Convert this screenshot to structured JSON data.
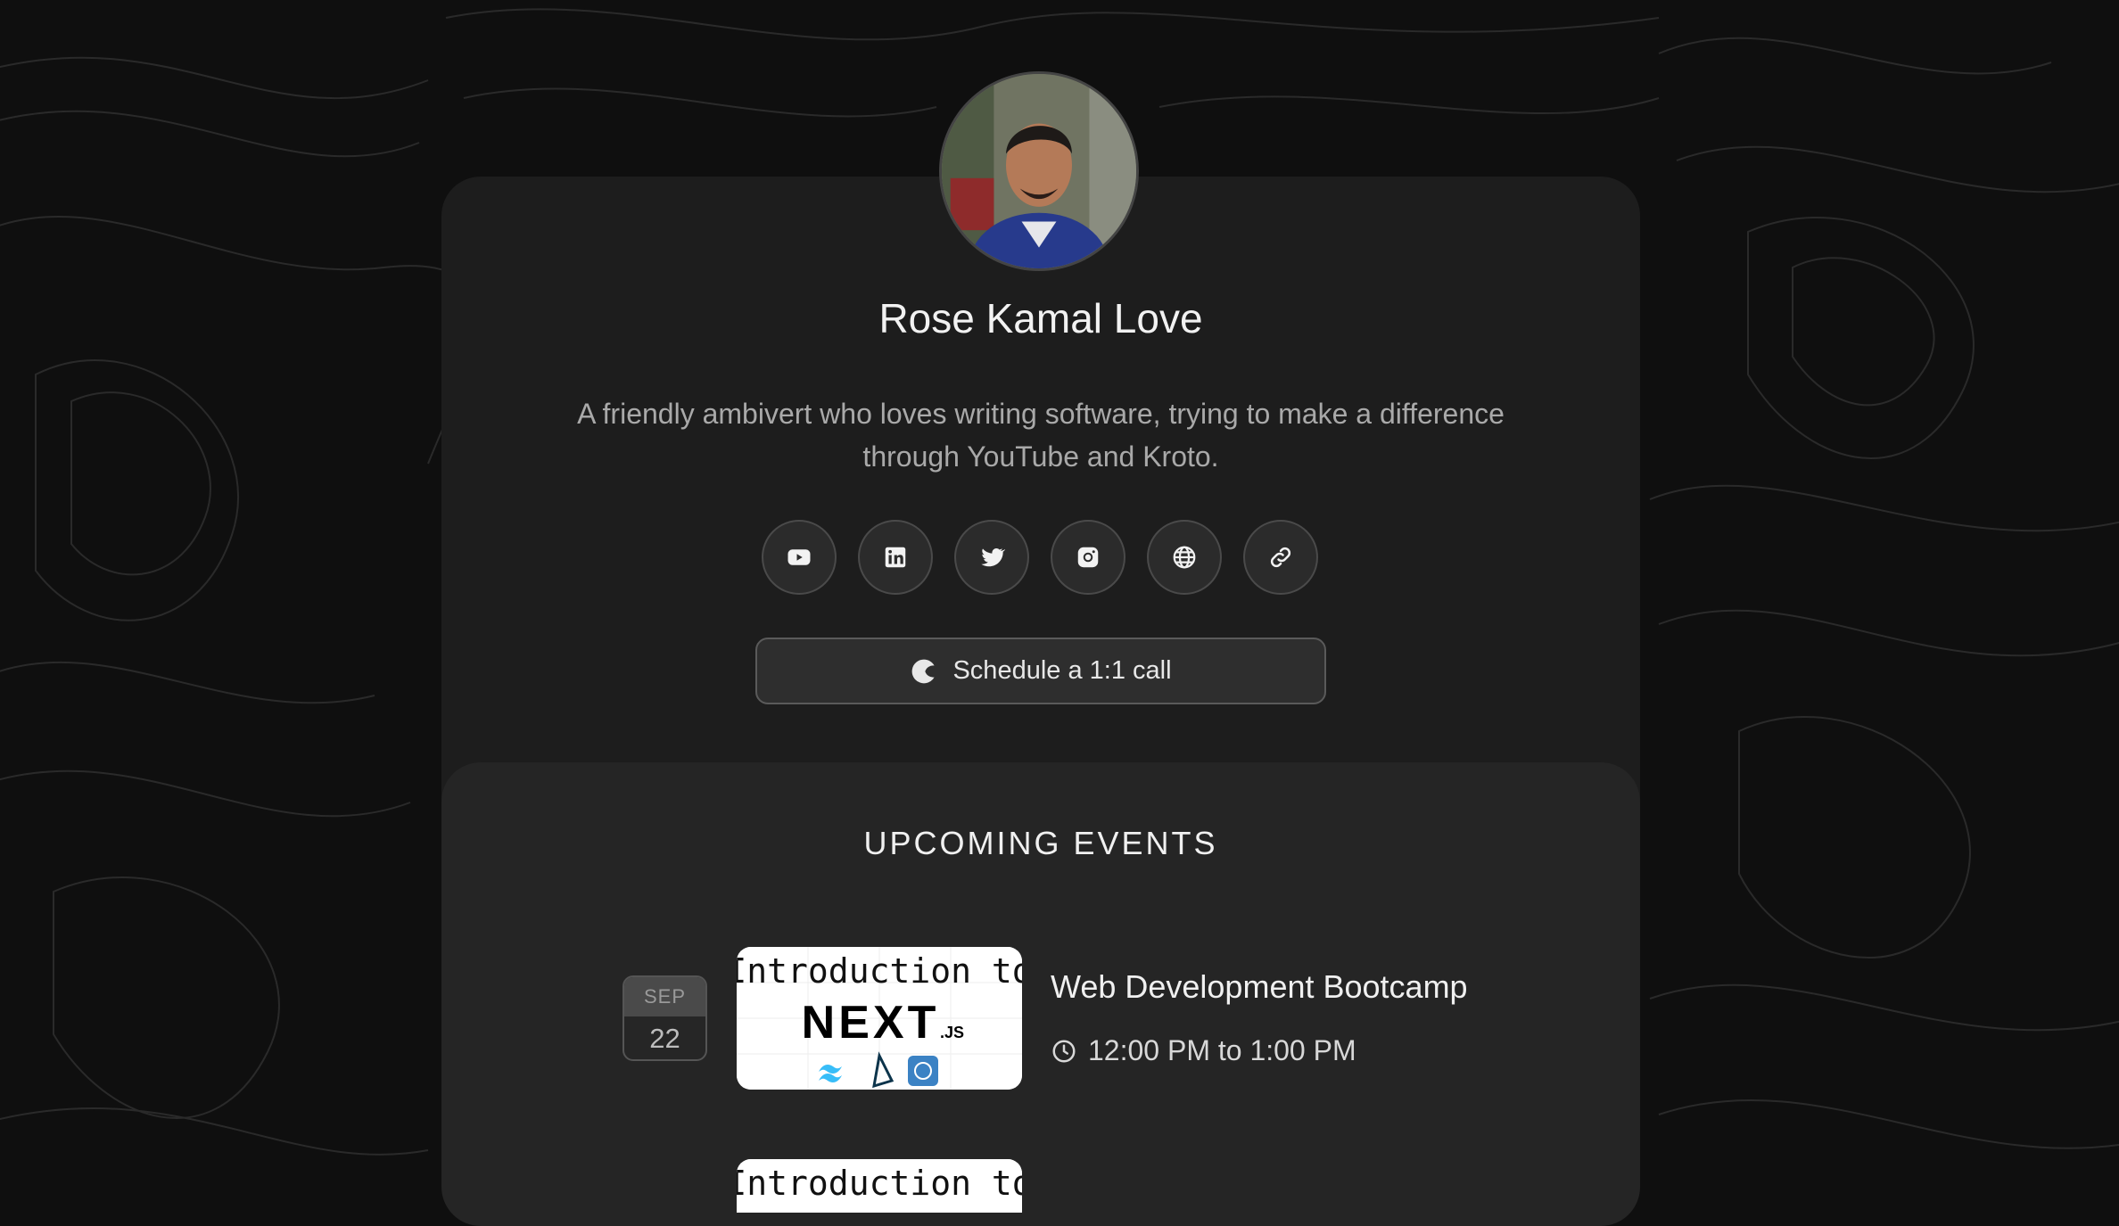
{
  "profile": {
    "name": "Rose Kamal Love",
    "bio": "A friendly ambivert who loves writing software, trying to make a difference through YouTube and Kroto."
  },
  "socials": [
    {
      "icon": "youtube-icon"
    },
    {
      "icon": "linkedin-icon"
    },
    {
      "icon": "twitter-icon"
    },
    {
      "icon": "instagram-icon"
    },
    {
      "icon": "globe-icon"
    },
    {
      "icon": "link-icon"
    }
  ],
  "schedule": {
    "label": "Schedule a 1:1 call",
    "icon": "kroto-logo-icon"
  },
  "events": {
    "heading": "UPCOMING EVENTS",
    "items": [
      {
        "month": "SEP",
        "day": "22",
        "title": "Web Development Bootcamp",
        "time": "12:00 PM to 1:00 PM",
        "thumbnail": {
          "line1": "Introduction to",
          "line2": "NEXT",
          "suffix": ".JS"
        }
      }
    ],
    "next_thumbnail_text": "Introduction to"
  },
  "colors": {
    "background": "#0f0f0f",
    "card": "#1d1d1d",
    "events_panel": "#252525",
    "text_primary": "#f0f0f0",
    "text_secondary": "#a9a9a9"
  }
}
